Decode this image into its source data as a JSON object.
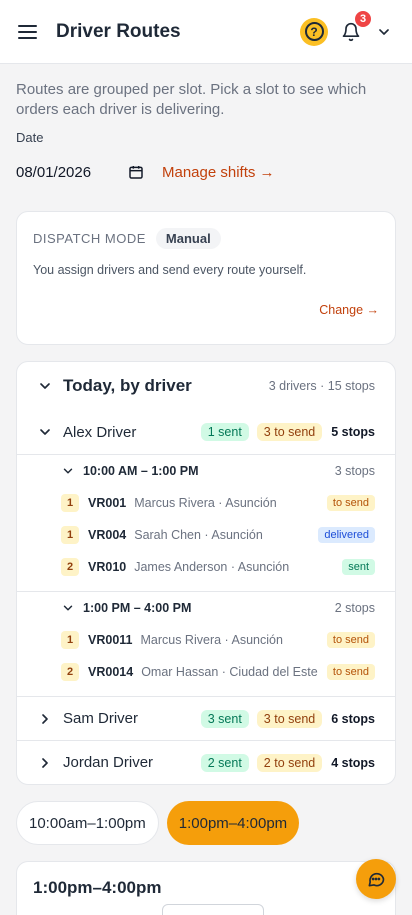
{
  "header": {
    "title": "Driver Routes",
    "help_glyph": "?",
    "notifications_count": "3"
  },
  "intro": "Routes are grouped per slot. Pick a slot to see which orders each driver is delivering.",
  "date": {
    "label": "Date",
    "value": "08/01/2026",
    "manage_shifts": "Manage shifts →"
  },
  "dispatch": {
    "label": "DISPATCH MODE",
    "mode": "Manual",
    "description": "You assign drivers and send every route yourself.",
    "change": "Change →"
  },
  "today": {
    "title": "Today, by driver",
    "meta": "3 drivers · 15 stops",
    "drivers": [
      {
        "name": "Alex Driver",
        "sent": "1 sent",
        "to_send": "3 to send",
        "stops": "5 stops",
        "slots": [
          {
            "time": "10:00 AM – 1:00 PM",
            "stops": "3 stops",
            "orders": [
              {
                "seq": "1",
                "id": "VR001",
                "who": "Marcus Rivera · Asunción",
                "status": "to send"
              },
              {
                "seq": "1",
                "id": "VR004",
                "who": "Sarah Chen · Asunción",
                "status": "delivered"
              },
              {
                "seq": "2",
                "id": "VR010",
                "who": "James Anderson · Asunción",
                "status": "sent"
              }
            ]
          },
          {
            "time": "1:00 PM – 4:00 PM",
            "stops": "2 stops",
            "orders": [
              {
                "seq": "1",
                "id": "VR0011",
                "who": "Marcus Rivera · Asunción",
                "status": "to send"
              },
              {
                "seq": "2",
                "id": "VR0014",
                "who": "Omar Hassan · Ciudad del Este",
                "status": "to send"
              }
            ]
          }
        ]
      },
      {
        "name": "Sam Driver",
        "sent": "3 sent",
        "to_send": "3 to send",
        "stops": "6 stops"
      },
      {
        "name": "Jordan Driver",
        "sent": "2 sent",
        "to_send": "2 to send",
        "stops": "4 stops"
      }
    ]
  },
  "slot_tabs": [
    "10:00am–1:00pm",
    "1:00pm–4:00pm"
  ],
  "active_slot": "1:00pm–4:00pm",
  "slot_panel_title": "1:00pm–4:00pm",
  "colors": {
    "accent": "#f59e0b",
    "link": "#c2410c",
    "badge": "#ef4444"
  },
  "icons": [
    "menu-icon",
    "help-icon",
    "bell-icon",
    "chevron-down-icon",
    "calendar-icon",
    "chevron-right-icon",
    "chat-icon"
  ]
}
